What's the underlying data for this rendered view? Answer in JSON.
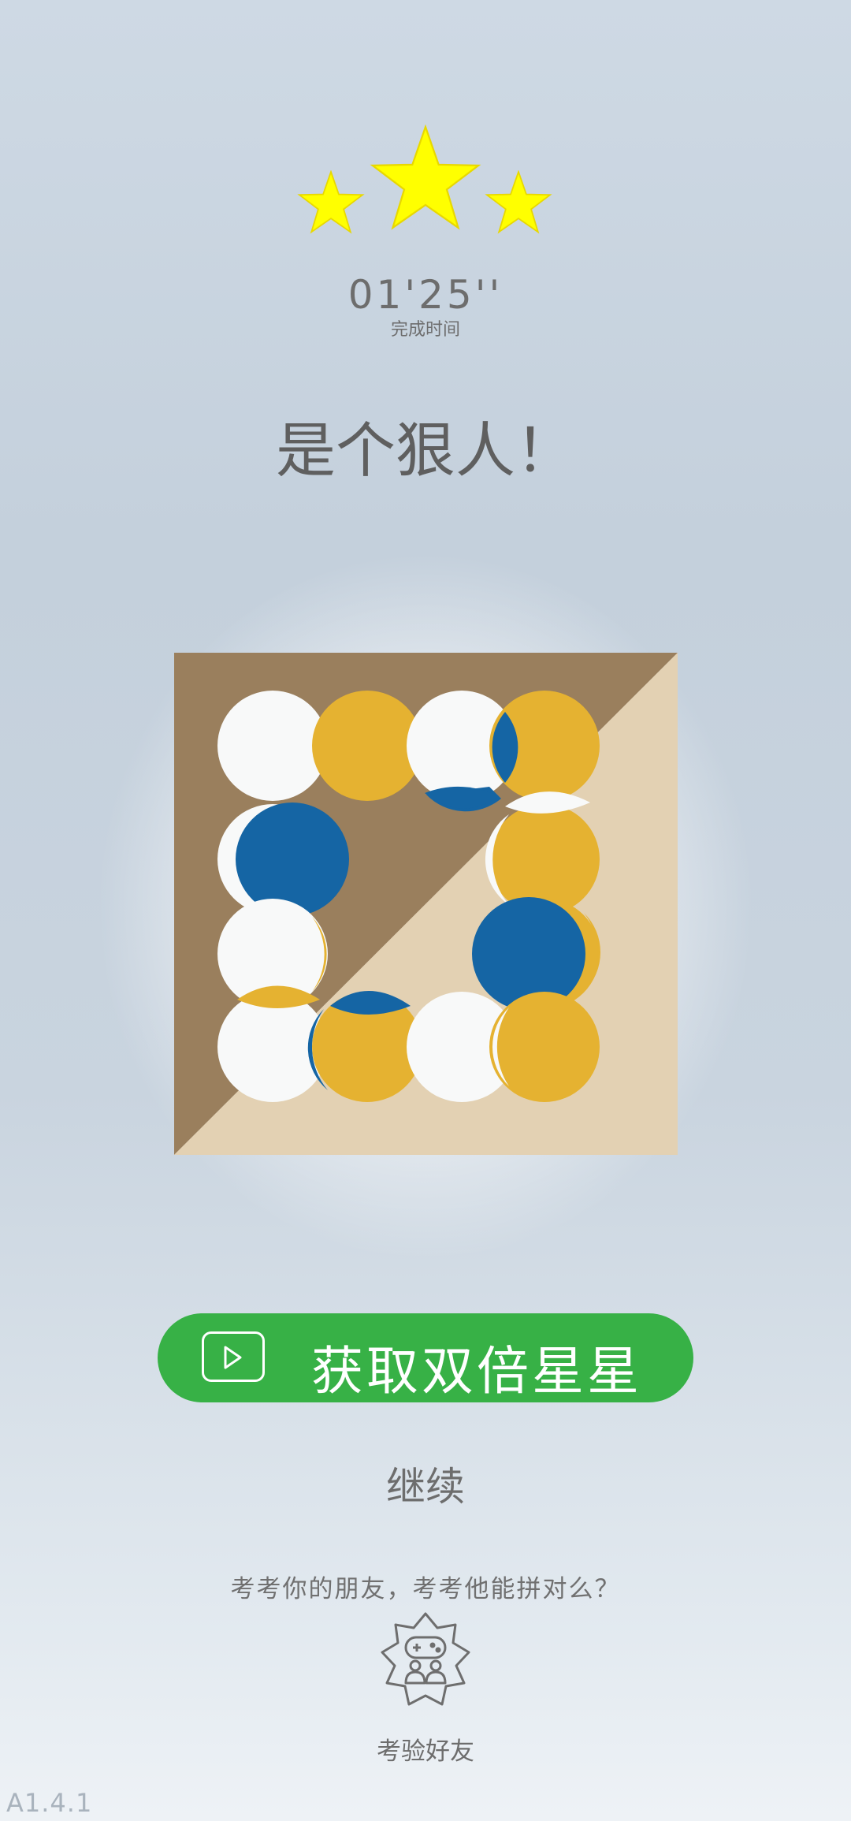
{
  "stars": {
    "earned": 3,
    "total": 3,
    "icon": "star-icon",
    "color": "#ffff00"
  },
  "result": {
    "time": "01'25''",
    "time_label": "完成时间",
    "title": "是个狠人！"
  },
  "board": {
    "colors": {
      "dark_tan": "#9a7f5d",
      "light_tan": "#e3d1b3",
      "white": "#f8f9f9",
      "gold": "#e5b231",
      "blue": "#1565a4"
    }
  },
  "actions": {
    "reward_label": "获取双倍星星",
    "reward_icon": "play-video-icon",
    "reward_color": "#37b146",
    "continue_label": "继续",
    "challenge_text": "考考你的朋友，考考他能拼对么？",
    "friend_icon": "gamepad-friends-icon",
    "friend_label": "考验好友"
  },
  "version": "A1.4.1"
}
